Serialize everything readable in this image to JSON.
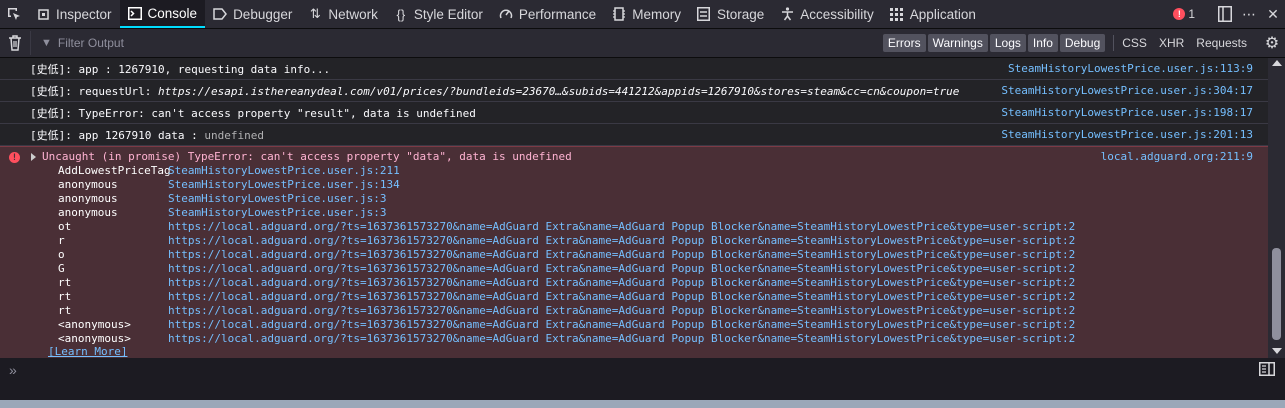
{
  "tabs": [
    {
      "label": "Inspector",
      "icon": "inspector-icon"
    },
    {
      "label": "Console",
      "icon": "console-icon",
      "active": true
    },
    {
      "label": "Debugger",
      "icon": "debugger-icon"
    },
    {
      "label": "Network",
      "icon": "network-icon"
    },
    {
      "label": "Style Editor",
      "icon": "style-editor-icon"
    },
    {
      "label": "Performance",
      "icon": "performance-icon"
    },
    {
      "label": "Memory",
      "icon": "memory-icon"
    },
    {
      "label": "Storage",
      "icon": "storage-icon"
    },
    {
      "label": "Accessibility",
      "icon": "accessibility-icon"
    },
    {
      "label": "Application",
      "icon": "application-icon"
    }
  ],
  "error_count": "1",
  "filter": {
    "placeholder": "Filter Output"
  },
  "levels": [
    "Errors",
    "Warnings",
    "Logs",
    "Info",
    "Debug"
  ],
  "extra_filters": [
    "CSS",
    "XHR",
    "Requests"
  ],
  "logs": [
    {
      "prefix": "[史低]: ",
      "message": "app : 1267910, requesting data info...",
      "location": "SteamHistoryLowestPrice.user.js:113:9"
    },
    {
      "prefix": "[史低]: ",
      "label": "requestUrl: ",
      "message": "https://esapi.isthereanydeal.com/v01/prices/?bundleids=23670…&subids=441212&appids=1267910&stores=steam&cc=cn&coupon=true",
      "location": "SteamHistoryLowestPrice.user.js:304:17"
    },
    {
      "prefix": "[史低]: ",
      "message": "TypeError: can't access property \"result\", data is undefined",
      "location": "SteamHistoryLowestPrice.user.js:198:17"
    },
    {
      "prefix": "[史低]: ",
      "message": "app 1267910 data : ",
      "value": "undefined",
      "location": "SteamHistoryLowestPrice.user.js:201:13"
    }
  ],
  "error": {
    "message": "Uncaught (in promise) TypeError: can't access property \"data\", data is undefined",
    "location": "local.adguard.org:211:9",
    "stack": [
      {
        "fn": "AddLowestPriceTag",
        "src": "SteamHistoryLowestPrice.user.js:211"
      },
      {
        "fn": "anonymous",
        "src": "SteamHistoryLowestPrice.user.js:134"
      },
      {
        "fn": "anonymous",
        "src": "SteamHistoryLowestPrice.user.js:3"
      },
      {
        "fn": "anonymous",
        "src": "SteamHistoryLowestPrice.user.js:3"
      },
      {
        "fn": "ot",
        "src": "https://local.adguard.org/?ts=1637361573270&name=AdGuard Extra&name=AdGuard Popup Blocker&name=SteamHistoryLowestPrice&type=user-script:2"
      },
      {
        "fn": "r",
        "src": "https://local.adguard.org/?ts=1637361573270&name=AdGuard Extra&name=AdGuard Popup Blocker&name=SteamHistoryLowestPrice&type=user-script:2"
      },
      {
        "fn": "o",
        "src": "https://local.adguard.org/?ts=1637361573270&name=AdGuard Extra&name=AdGuard Popup Blocker&name=SteamHistoryLowestPrice&type=user-script:2"
      },
      {
        "fn": "G",
        "src": "https://local.adguard.org/?ts=1637361573270&name=AdGuard Extra&name=AdGuard Popup Blocker&name=SteamHistoryLowestPrice&type=user-script:2"
      },
      {
        "fn": "rt",
        "src": "https://local.adguard.org/?ts=1637361573270&name=AdGuard Extra&name=AdGuard Popup Blocker&name=SteamHistoryLowestPrice&type=user-script:2"
      },
      {
        "fn": "rt",
        "src": "https://local.adguard.org/?ts=1637361573270&name=AdGuard Extra&name=AdGuard Popup Blocker&name=SteamHistoryLowestPrice&type=user-script:2"
      },
      {
        "fn": "rt",
        "src": "https://local.adguard.org/?ts=1637361573270&name=AdGuard Extra&name=AdGuard Popup Blocker&name=SteamHistoryLowestPrice&type=user-script:2"
      },
      {
        "fn": "<anonymous>",
        "src": "https://local.adguard.org/?ts=1637361573270&name=AdGuard Extra&name=AdGuard Popup Blocker&name=SteamHistoryLowestPrice&type=user-script:2"
      },
      {
        "fn": "<anonymous>",
        "src": "https://local.adguard.org/?ts=1637361573270&name=AdGuard Extra&name=AdGuard Popup Blocker&name=SteamHistoryLowestPrice&type=user-script:2"
      }
    ],
    "learn_more": "[Learn More]"
  },
  "prompt": "»"
}
